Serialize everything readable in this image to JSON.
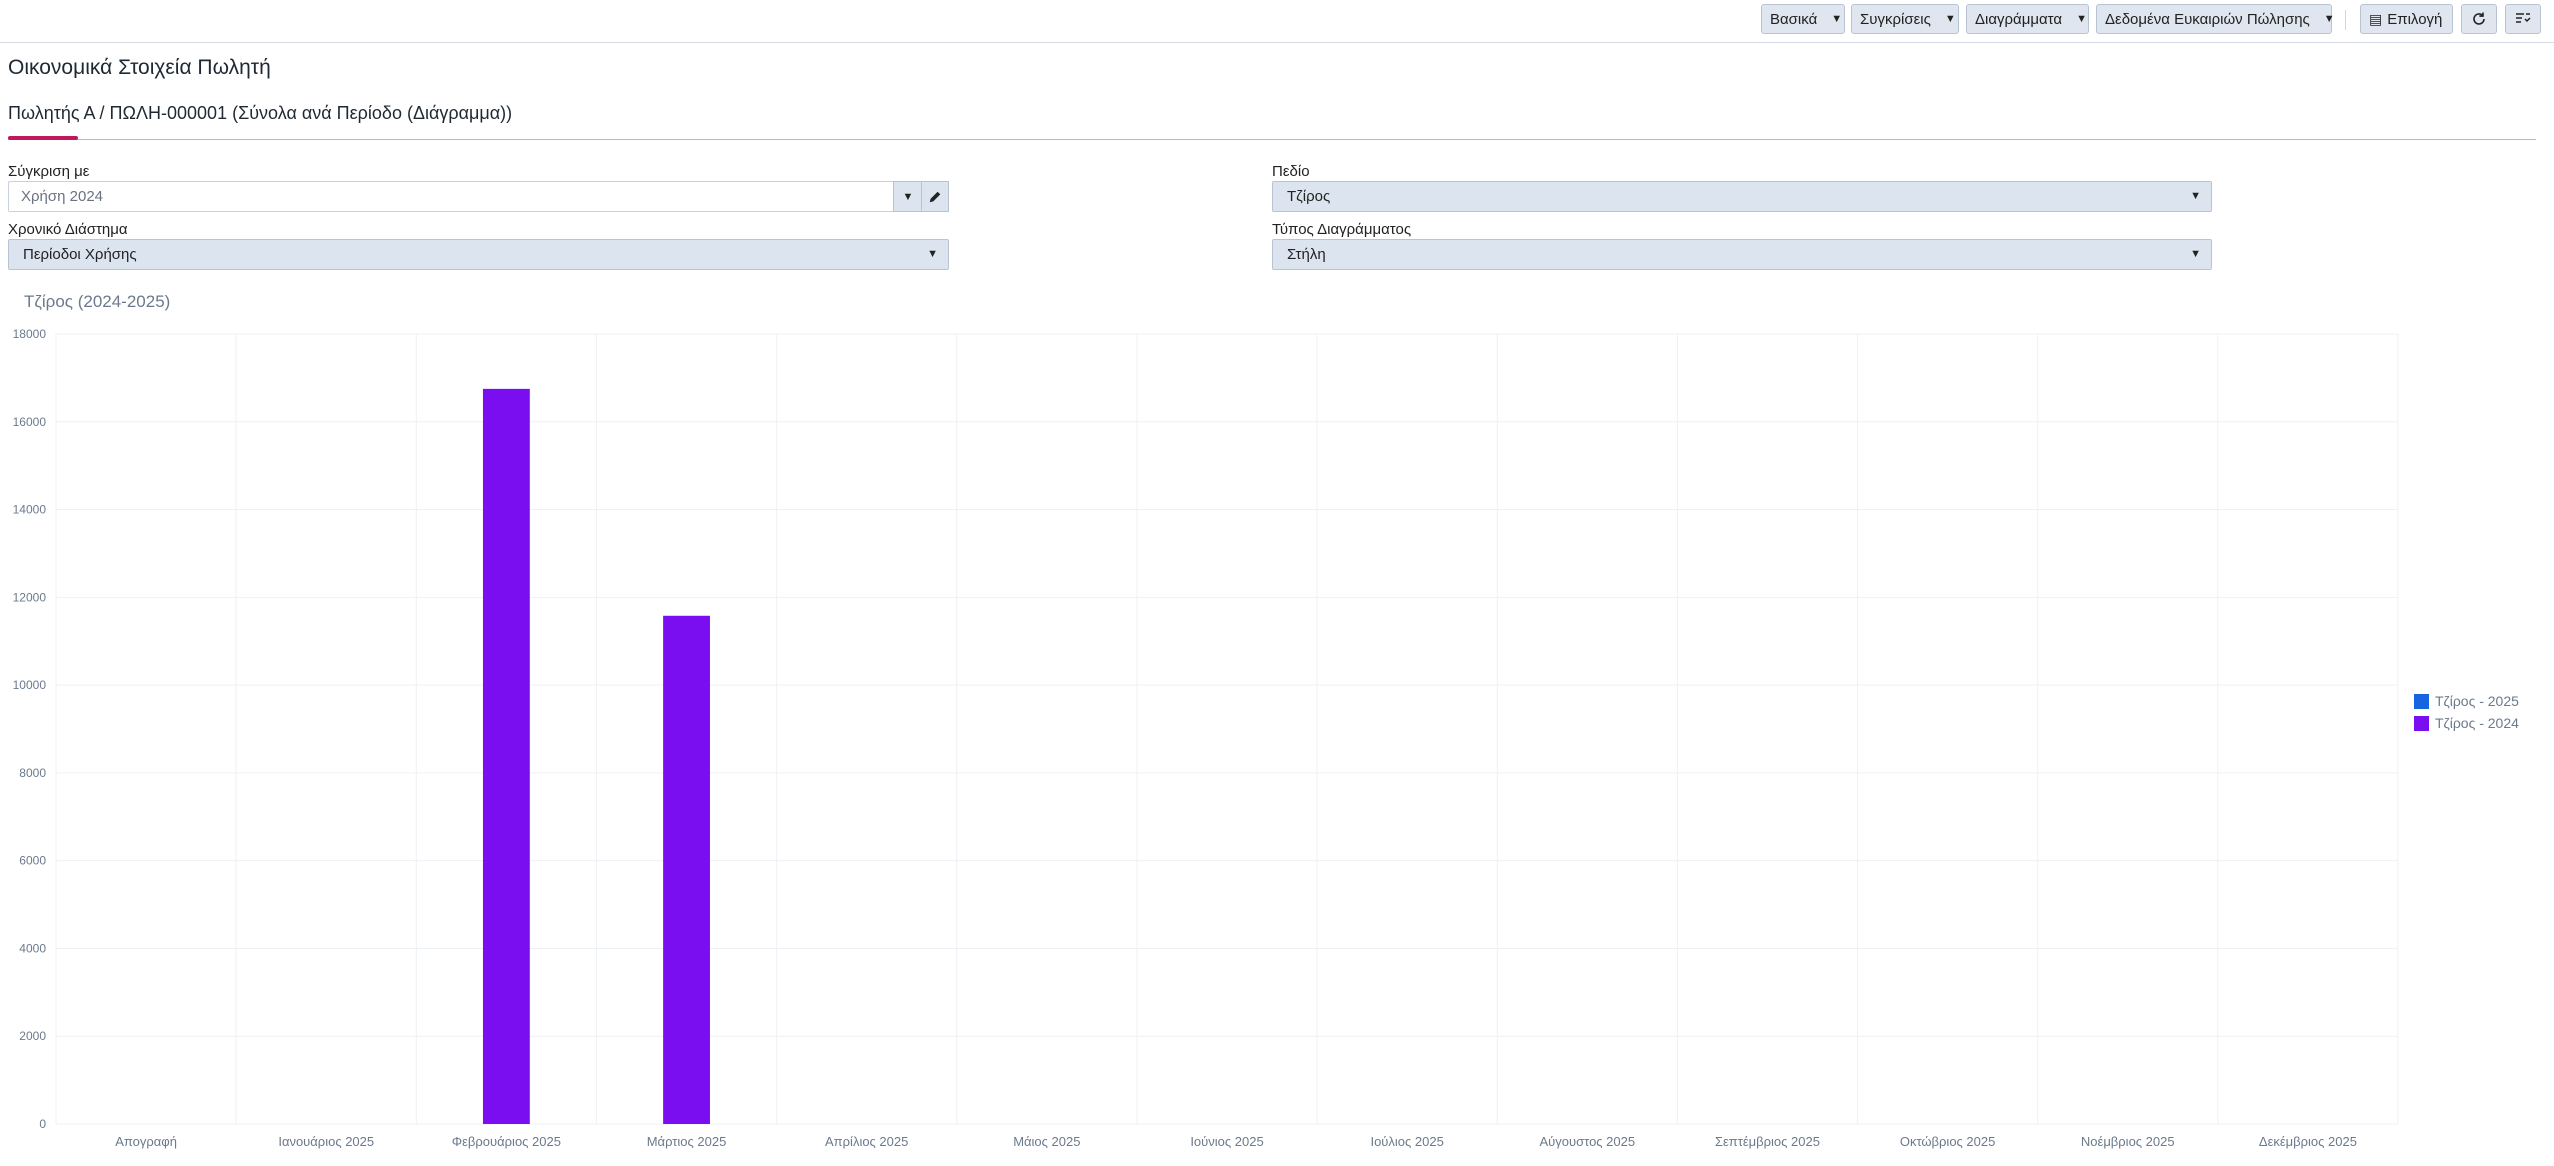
{
  "toolbar": {
    "basic": "Βασικά",
    "comparisons": "Συγκρίσεις",
    "charts": "Διαγράμματα",
    "sales_data": "Δεδομένα Ευκαιριών Πώλησης",
    "select": "Επιλογή"
  },
  "page": {
    "title": "Οικονομικά Στοιχεία Πωλητή",
    "subtitle": "Πωλητής Α / ΠΩΛΗ-000001 (Σύνολα ανά Περίοδο (Διάγραμμα))"
  },
  "form": {
    "compare_label": "Σύγκριση με",
    "compare_value": "Χρήση 2024",
    "period_label": "Χρονικό Διάστημα",
    "period_value": "Περίοδοι Χρήσης",
    "field_label": "Πεδίο",
    "field_value": "Τζίρος",
    "chart_type_label": "Τύπος Διαγράμματος",
    "chart_type_value": "Στήλη"
  },
  "chart_data": {
    "type": "bar",
    "title": "Τζίρος (2024-2025)",
    "categories": [
      "Απογραφή",
      "Ιανουάριος 2025",
      "Φεβρουάριος 2025",
      "Μάρτιος 2025",
      "Απρίλιος 2025",
      "Μάιος 2025",
      "Ιούνιος 2025",
      "Ιούλιος 2025",
      "Αύγουστος 2025",
      "Σεπτέμβριος 2025",
      "Οκτώβριος 2025",
      "Νοέμβριος 2025",
      "Δεκέμβριος 2025"
    ],
    "series": [
      {
        "name": "Τζίρος - 2025",
        "color": "#1565e0",
        "values": [
          0,
          0,
          0,
          0,
          0,
          0,
          0,
          0,
          0,
          0,
          0,
          0,
          0
        ]
      },
      {
        "name": "Τζίρος - 2024",
        "color": "#7b0ef0",
        "values": [
          0,
          0,
          16750,
          11580,
          0,
          0,
          0,
          0,
          0,
          0,
          0,
          0,
          0
        ]
      }
    ],
    "ylim": [
      0,
      18000
    ],
    "yticks": [
      "0",
      "2000",
      "4000",
      "6000",
      "8000",
      "10000",
      "12000",
      "14000",
      "16000",
      "18000"
    ],
    "grid": true,
    "legend_position": "right"
  }
}
